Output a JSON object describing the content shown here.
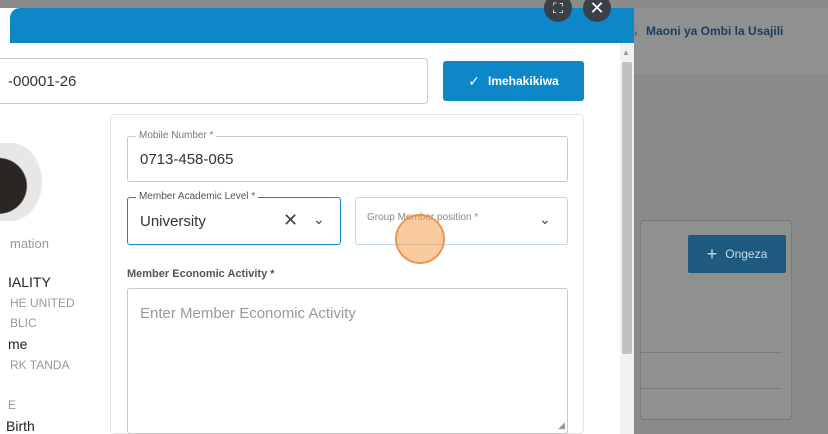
{
  "background": {
    "header_label": "Maoni ya Ombi la Usajili",
    "add_button": "Ongeza"
  },
  "modal": {
    "application_number": "-00001-26",
    "verify_button": "Imehakikiwa",
    "left_column": {
      "section": "mation",
      "nationality_label": "IALITY",
      "nationality_value_1": "HE UNITED",
      "nationality_value_2": "BLIC",
      "name_label": "me",
      "name_value": "RK TANDA",
      "dob_marker": "E",
      "dob_label": "Birth"
    },
    "form": {
      "mobile": {
        "label": "Mobile Number *",
        "value": "0713-458-065"
      },
      "academic": {
        "label": "Member Academic Level *",
        "value": "University"
      },
      "group_position": {
        "placeholder": "Group Member position *"
      },
      "economic": {
        "label": "Member Economic Activity *",
        "placeholder": "Enter Member Economic Activity"
      }
    }
  },
  "colors": {
    "primary": "#0e87c8",
    "overlay": "#8a8a8a",
    "dark_bg_button": "#1e5a80"
  }
}
